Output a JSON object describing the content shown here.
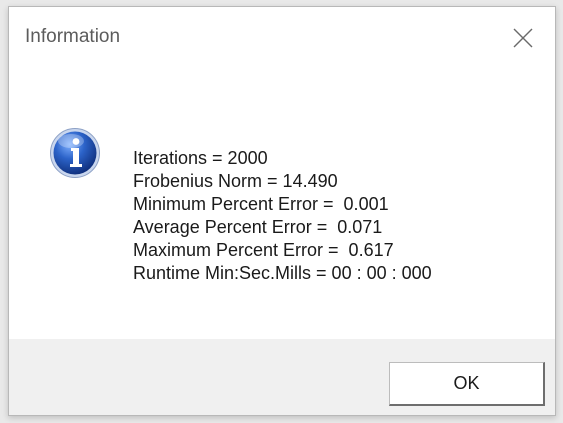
{
  "window": {
    "title": "Information",
    "close_icon": "close-icon"
  },
  "message": {
    "icon": "info-icon",
    "lines": [
      "Iterations = 2000",
      "Frobenius Norm = 14.490",
      "Minimum Percent Error =  0.001",
      "Average Percent Error =  0.071",
      "Maximum Percent Error =  0.617",
      "Runtime Min:Sec.Mills = 00 : 00 : 000"
    ]
  },
  "buttons": {
    "ok_label": "OK"
  },
  "colors": {
    "icon_blue": "#1f4fa8",
    "dialog_bg": "#ffffff",
    "footer_bg": "#f0f0f0"
  }
}
